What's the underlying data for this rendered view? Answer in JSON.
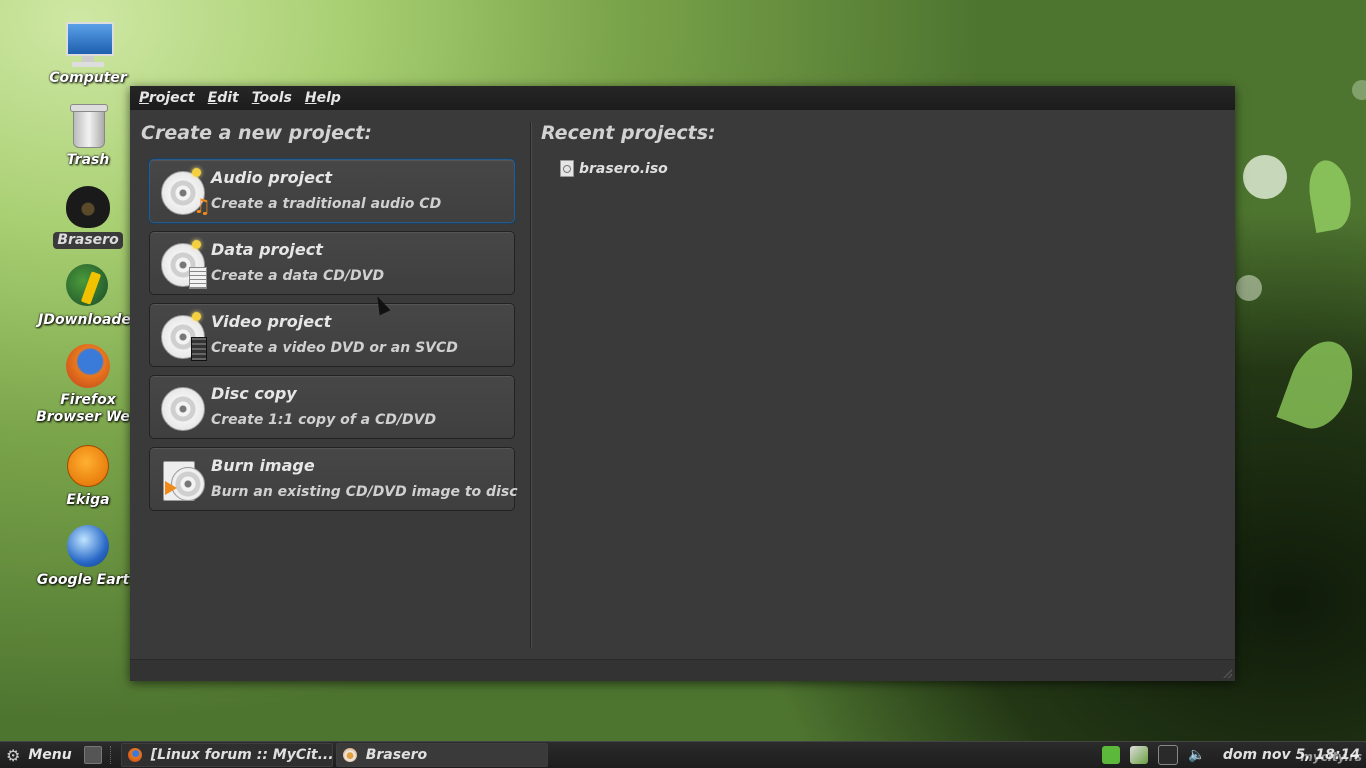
{
  "desktop": {
    "icons": [
      {
        "label": "Computer",
        "icon": "computer-icon"
      },
      {
        "label": "Trash",
        "icon": "trash-icon"
      },
      {
        "label": "Brasero",
        "icon": "brasero-icon"
      },
      {
        "label": "JDownloader",
        "icon": "jdownloader-icon"
      },
      {
        "label": "Firefox Browser Web",
        "icon": "firefox-icon"
      },
      {
        "label": "Ekiga",
        "icon": "ekiga-icon"
      },
      {
        "label": "Google Earth",
        "icon": "google-earth-icon"
      }
    ],
    "watermark": "mycity.rs"
  },
  "window": {
    "menu": [
      "Project",
      "Edit",
      "Tools",
      "Help"
    ],
    "new_project_heading": "Create a new project:",
    "recent_heading": "Recent projects:",
    "projects": [
      {
        "title": "Audio project",
        "subtitle": "Create a traditional audio CD",
        "icon": "audio-disc-icon"
      },
      {
        "title": "Data project",
        "subtitle": "Create a data CD/DVD",
        "icon": "data-disc-icon"
      },
      {
        "title": "Video project",
        "subtitle": "Create a video DVD or an SVCD",
        "icon": "video-disc-icon"
      },
      {
        "title": "Disc copy",
        "subtitle": "Create 1:1 copy of a CD/DVD",
        "icon": "disc-copy-icon"
      },
      {
        "title": "Burn image",
        "subtitle": "Burn an existing CD/DVD image to disc",
        "icon": "burn-image-icon"
      }
    ],
    "recent": [
      {
        "name": "brasero.iso",
        "icon": "iso-file-icon"
      }
    ]
  },
  "taskbar": {
    "menu_label": "Menu",
    "tasks": [
      {
        "label": "[Linux forum :: MyCit...",
        "icon": "firefox-icon"
      },
      {
        "label": "Brasero",
        "icon": "brasero-icon"
      }
    ],
    "clock": "dom nov 5, 18:14"
  },
  "colors": {
    "window_bg": "#3a3a3a",
    "focus_border": "#2a5a86",
    "desktop_green": "#7aa44a"
  }
}
